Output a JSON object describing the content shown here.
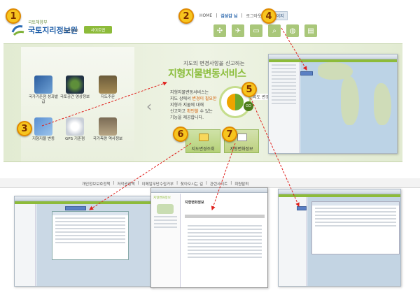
{
  "markers": [
    "1",
    "2",
    "3",
    "4",
    "5",
    "6",
    "7"
  ],
  "header": {
    "org_sub": "국토해양부",
    "org_name": "국토지리정보원",
    "org_tag": "공간정보",
    "site_button": "사이트맵",
    "nav": {
      "home": "HOME",
      "user": "김성갑 님",
      "logout": "로그아웃",
      "mypage": "홈페이지"
    },
    "icons": [
      "network-icon",
      "airplane-icon",
      "folder-icon",
      "magnifier-icon",
      "globe-icon",
      "book-icon"
    ]
  },
  "services": [
    {
      "label": "국가기준점 성과발급"
    },
    {
      "label": "국토공간 영상정보"
    },
    {
      "label": "지도주문"
    },
    {
      "label": "지형지물 변동"
    },
    {
      "label": "GPS 기준점"
    },
    {
      "label": "국가측량 역사정보"
    }
  ],
  "banner": {
    "subtitle": "지도의 변경사항을 신고하는",
    "title": "지형지물변동서비스",
    "desc_1": "지형지물변동서비스는",
    "desc_2a": "지도 상에서 ",
    "desc_2b": "변경이 필요한",
    "desc_3": "지형과 지물에 대해",
    "desc_4a": "신고하고 ",
    "desc_4b": "확인할",
    "desc_4c": " 수 있는",
    "desc_5": "기능을 제공합니다.",
    "go": "GO",
    "map_tab": "지도 변경신",
    "btn6_label": "지도변경조회",
    "btn7_label": "지형변화정보"
  },
  "bottom": {
    "links": [
      "개인정보보호정책",
      "저작권정책",
      "이메일무단수집거부",
      "찾아오시는 길",
      "관련사이트",
      "회원탈퇴"
    ]
  },
  "popup": {
    "side_title": "지형변화정보",
    "title": "지형변화정보"
  },
  "colors": {
    "accent_green": "#8dbb3a",
    "marker_yellow": "#f7c51e",
    "arrow_red": "#e0201c"
  }
}
